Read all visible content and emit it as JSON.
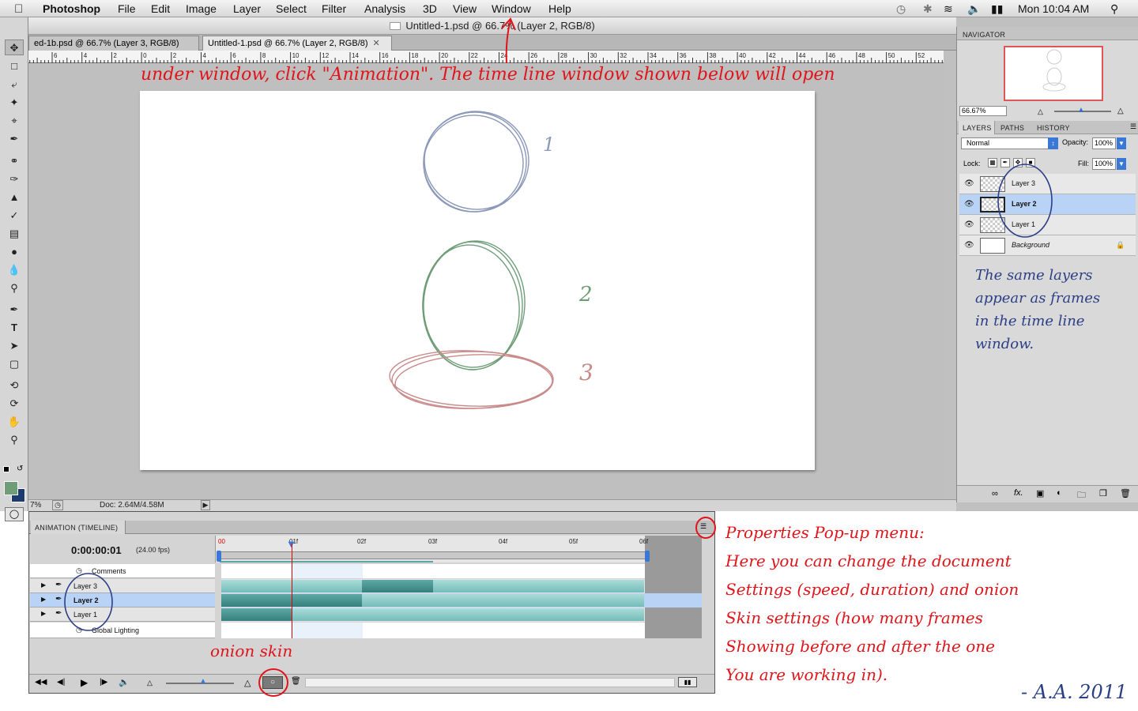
{
  "menubar": {
    "app_name": "Photoshop",
    "items": [
      "File",
      "Edit",
      "Image",
      "Layer",
      "Select",
      "Filter",
      "Analysis",
      "3D",
      "View",
      "Window",
      "Help"
    ],
    "clock": "Mon 10:04 AM"
  },
  "document": {
    "title": "Untitled-1.psd @ 66.7% (Layer 2, RGB/8)",
    "tabs": [
      {
        "label": "ed-1b.psd @ 66.7% (Layer 3, RGB/8) *",
        "close": "✕"
      },
      {
        "label": "Untitled-1.psd @ 66.7% (Layer 2, RGB/8)",
        "close": "✕"
      }
    ],
    "ruler_labels": [
      "6",
      "4",
      "2",
      "0",
      "2",
      "4",
      "6",
      "8",
      "10",
      "12",
      "14",
      "16",
      "18",
      "20",
      "22",
      "24",
      "26",
      "28",
      "30",
      "32",
      "34",
      "36",
      "38",
      "40",
      "42",
      "44",
      "46",
      "48",
      "50",
      "52"
    ],
    "sketch_labels": [
      "1",
      "2",
      "3"
    ]
  },
  "statusbar": {
    "zoom": "7%",
    "doc_size": "Doc: 2.64M/4.58M"
  },
  "navigator": {
    "title": "NAVIGATOR",
    "zoom": "66.67%"
  },
  "layers_panel": {
    "tabs": [
      "LAYERS",
      "PATHS",
      "HISTORY"
    ],
    "blend_mode": "Normal",
    "opacity_label": "Opacity:",
    "opacity_value": "100%",
    "lock_label": "Lock:",
    "fill_label": "Fill:",
    "fill_value": "100%",
    "layers": [
      {
        "name": "Layer 3",
        "selected": false
      },
      {
        "name": "Layer 2",
        "selected": true
      },
      {
        "name": "Layer 1",
        "selected": false
      },
      {
        "name": "Background",
        "selected": false
      }
    ]
  },
  "timeline": {
    "title": "ANIMATION (TIMELINE)",
    "current_time": "0:00:00:01",
    "fps": "(24.00 fps)",
    "frame_labels": [
      "00",
      "01f",
      "02f",
      "03f",
      "04f",
      "05f",
      "06f"
    ],
    "rows": [
      {
        "name": "Comments"
      },
      {
        "name": "Layer 3"
      },
      {
        "name": "Layer 2"
      },
      {
        "name": "Layer 1"
      },
      {
        "name": "Global Lighting"
      }
    ]
  },
  "annotations": {
    "window_note": "under window, click \"Animation\". The time line window shown below will open",
    "layers_note": [
      "The same layers",
      "appear as frames",
      "in the time line",
      "window."
    ],
    "properties_note": [
      "Properties  Pop-up menu:",
      "Here you can change the document",
      "Settings (speed, duration) and onion",
      "Skin settings (how many frames",
      "Showing before and after the one",
      "You are working in)."
    ],
    "onion_note": "onion skin",
    "signature": "- A.A. 2011"
  },
  "colors": {
    "annotation_red": "#e0141a",
    "annotation_blue": "#2b3f86",
    "selection_blue": "#b9d3f7",
    "timeline_bar": "#7fc3c0",
    "timeline_bar_dark": "#3e8e8c"
  }
}
